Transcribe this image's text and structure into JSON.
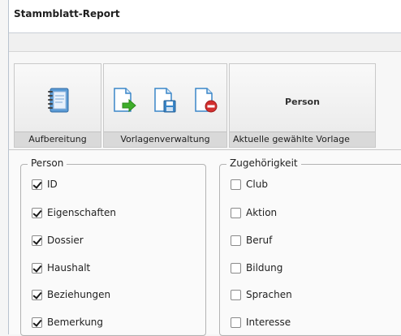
{
  "window": {
    "title": "Stammblatt-Report"
  },
  "ribbon": {
    "groups": [
      {
        "label": "Aufbereitung",
        "icons": [
          "notebook-icon"
        ]
      },
      {
        "label": "Vorlagenverwaltung",
        "icons": [
          "document-export-icon",
          "document-save-icon",
          "document-delete-icon"
        ]
      },
      {
        "label": "Aktuelle gewählte Vorlage",
        "current_template": "Person"
      }
    ]
  },
  "person": {
    "legend": "Person",
    "items": [
      {
        "label": "ID",
        "checked": true
      },
      {
        "label": "Eigenschaften",
        "checked": true
      },
      {
        "label": "Dossier",
        "checked": true
      },
      {
        "label": "Haushalt",
        "checked": true
      },
      {
        "label": "Beziehungen",
        "checked": true
      },
      {
        "label": "Bemerkung",
        "checked": true
      }
    ]
  },
  "zugehoerigkeit": {
    "legend": "Zugehörigkeit",
    "items": [
      {
        "label": "Club",
        "checked": false
      },
      {
        "label": "Aktion",
        "checked": false
      },
      {
        "label": "Beruf",
        "checked": false
      },
      {
        "label": "Bildung",
        "checked": false
      },
      {
        "label": "Sprachen",
        "checked": false
      },
      {
        "label": "Interesse",
        "checked": false
      }
    ]
  },
  "colors": {
    "accent_green": "#3fae2a",
    "accent_blue": "#3a86c8",
    "accent_red": "#d32f2f"
  }
}
